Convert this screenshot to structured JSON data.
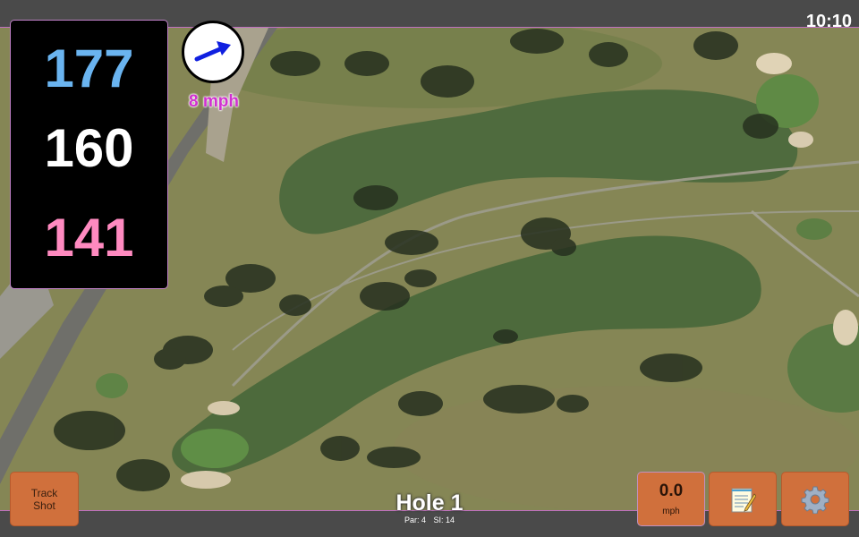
{
  "status_bar": {
    "time": "10:10"
  },
  "distances": {
    "back": "177",
    "middle": "160",
    "front": "141"
  },
  "wind": {
    "speed_label": "8 mph",
    "direction_icon": "arrow-icon"
  },
  "buttons": {
    "track_shot": {
      "line1": "Track",
      "line2": "Shot"
    },
    "speed": {
      "value": "0.0",
      "unit": "mph"
    },
    "notes_icon": "notepad-icon",
    "settings_icon": "gear-icon"
  },
  "hole": {
    "title": "Hole 1",
    "par_label": "Par: 4",
    "si_label": "SI: 14"
  },
  "colors": {
    "button_bg": "#d0703c",
    "back_distance": "#6ab4f0",
    "middle_distance": "#ffffff",
    "front_distance": "#ff8ac0",
    "wind_text": "#d030d0"
  }
}
